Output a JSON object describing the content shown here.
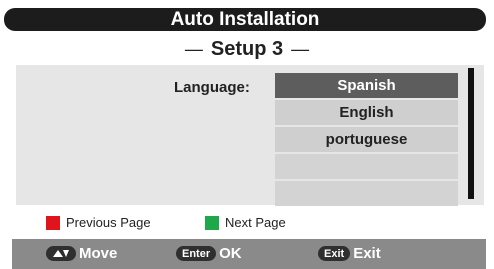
{
  "header": {
    "title": "Auto Installation"
  },
  "setup": {
    "title": "Setup 3"
  },
  "language": {
    "label": "Language:",
    "options": [
      "Spanish",
      "English",
      "portuguese",
      "",
      ""
    ],
    "selected": "Spanish"
  },
  "legend": {
    "previous": {
      "color": "#e0141c",
      "label": "Previous Page"
    },
    "next": {
      "color": "#1ea84a",
      "label": "Next Page"
    }
  },
  "footer": {
    "move": {
      "icon": "up-down-arrows-icon",
      "label": "Move"
    },
    "ok": {
      "key": "Enter",
      "label": "OK"
    },
    "exit": {
      "key": "Exit",
      "label": "Exit"
    }
  }
}
